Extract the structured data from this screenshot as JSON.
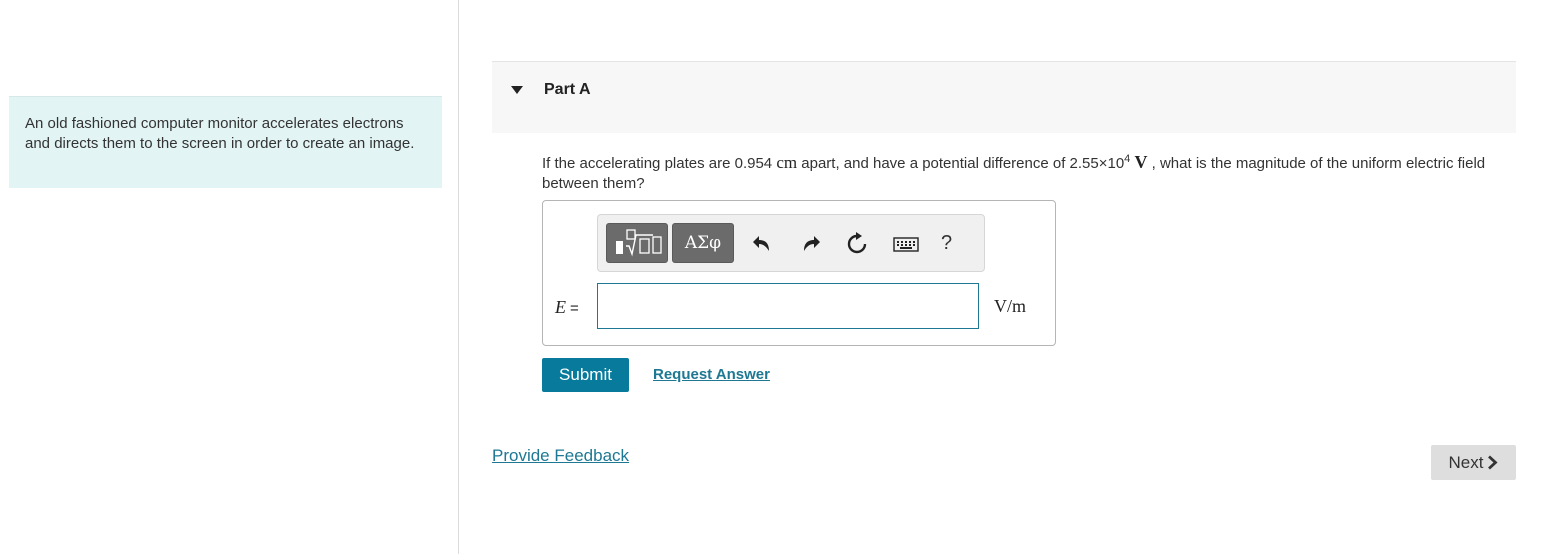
{
  "intro": {
    "text": "An old fashioned computer monitor accelerates electrons and directs them to the screen in order to create an image."
  },
  "part": {
    "title": "Part A"
  },
  "question": {
    "text_before": "If the accelerating plates are 0.954 ",
    "unit_cm": "cm",
    "text_middle": " apart, and have a potential difference of ",
    "pd_mantissa": "2.55×10",
    "pd_exponent": "4",
    "unit_v": "V",
    "text_after": " , what is the magnitude of the uniform electric field between them?"
  },
  "toolbar": {
    "greek_label": "ΑΣφ",
    "help_label": "?",
    "icons": [
      "templates-icon",
      "greek-letters-button",
      "undo-icon",
      "redo-icon",
      "reset-icon",
      "keyboard-icon",
      "help-icon"
    ]
  },
  "answer": {
    "variable": "E",
    "equals": "=",
    "value": "",
    "unit": "V/m"
  },
  "actions": {
    "submit_label": "Submit",
    "request_answer_label": "Request Answer",
    "feedback_label": "Provide Feedback",
    "next_label": "Next"
  },
  "colors": {
    "accent": "#087b9c",
    "link": "#1e7893",
    "intro_bg": "#e3f4f5"
  }
}
